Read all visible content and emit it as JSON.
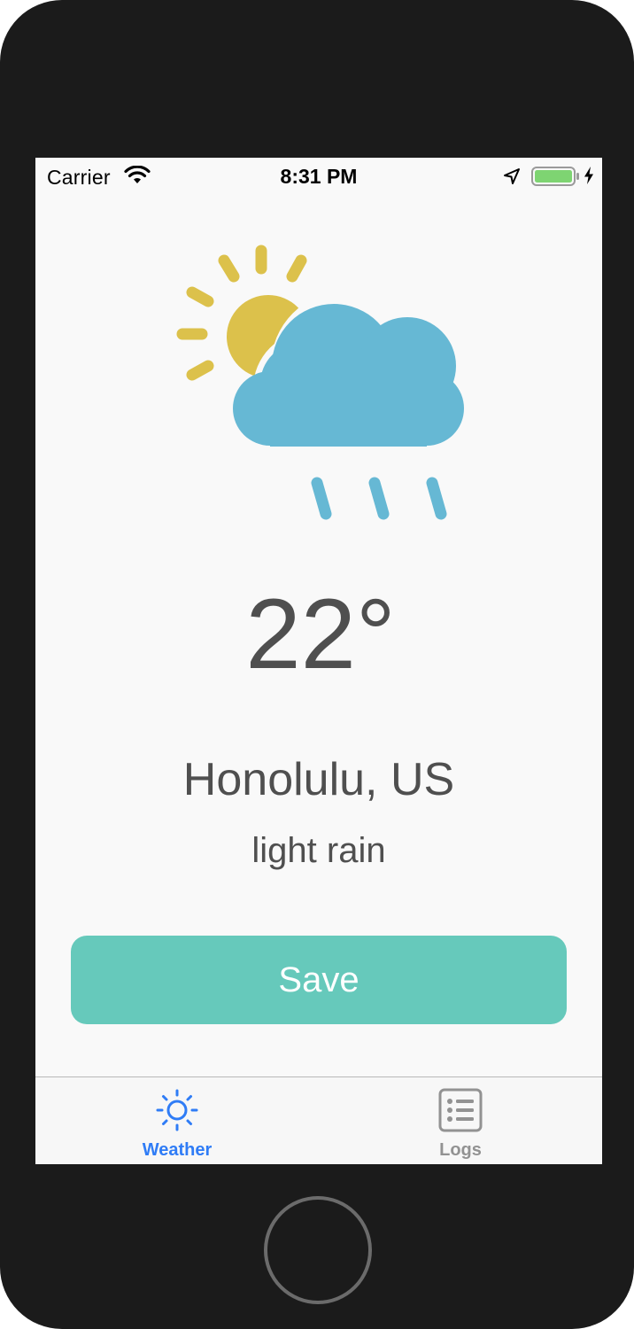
{
  "status_bar": {
    "carrier": "Carrier",
    "time": "8:31 PM",
    "icons": [
      "wifi-icon",
      "location-arrow-icon",
      "battery-icon",
      "charging-bolt-icon"
    ],
    "battery_color": "#7ed472"
  },
  "weather": {
    "icon": "partly-sunny-rain-icon",
    "temperature": "22°",
    "city": "Honolulu, US",
    "description": "light rain",
    "colors": {
      "sun": "#dcc14b",
      "cloud": "#66b8d4",
      "text": "#4f4f4f"
    }
  },
  "save_button": {
    "label": "Save",
    "color": "#66c9bb"
  },
  "tab_bar": {
    "tabs": [
      {
        "label": "Weather",
        "icon": "sun-icon",
        "selected": true,
        "color": "#2f7cf6"
      },
      {
        "label": "Logs",
        "icon": "list-icon",
        "selected": false,
        "color": "#929292"
      }
    ]
  }
}
